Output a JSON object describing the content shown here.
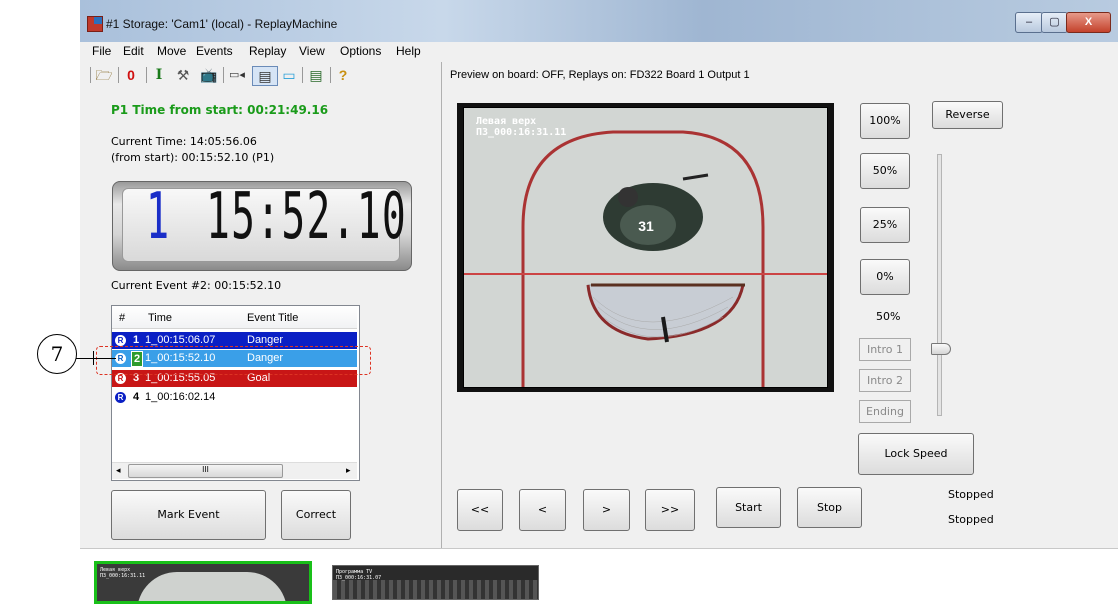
{
  "window": {
    "title": "#1 Storage: 'Cam1' (local) - ReplayMachine",
    "controls": {
      "minimize": "–",
      "maximize": "▢",
      "close": "X"
    }
  },
  "menu": [
    "File",
    "Edit",
    "Move",
    "Events",
    "Replay",
    "View",
    "Options",
    "Help"
  ],
  "toolbar": {
    "icons": [
      "open-folder-icon",
      "zero-icon",
      "input-icon",
      "tools-icon",
      "tv-icon",
      "camera-icon",
      "monitor-icon",
      "display-icon",
      "list-icon",
      "help-icon"
    ],
    "zero_label": "0",
    "input_label": "I",
    "help_label": "?"
  },
  "preview_status": "Preview on board: OFF, Replays on: FD322 Board 1 Output 1",
  "left": {
    "p1_time": "P1 Time from start: 00:21:49.16",
    "current_time": "Current Time: 14:05:56.06",
    "from_start": "(from start): 00:15:52.10 (P1)",
    "clock_hour": "1",
    "clock_rest": "15:52.10",
    "current_event": "Current Event #2: 00:15:52.10"
  },
  "events": {
    "headers": [
      "#",
      "Time",
      "Event Title"
    ],
    "rows": [
      {
        "icon": "R",
        "num": "1",
        "time": "1_00:15:06.07",
        "title": "Danger"
      },
      {
        "icon": "R",
        "num": "2",
        "time": "1_00:15:52.10",
        "title": "Danger"
      },
      {
        "icon": "R",
        "num": "3",
        "time": "1_00:15:55.05",
        "title": "Goal"
      },
      {
        "icon": "R",
        "num": "4",
        "time": "1_00:16:02.14",
        "title": ""
      }
    ],
    "scroll_left": "◂",
    "scroll_right": "▸",
    "scroll_grip": "III"
  },
  "callout": "7",
  "buttons": {
    "mark_event": "Mark Event",
    "correct": "Correct",
    "s100": "100%",
    "reverse": "Reverse",
    "s50": "50%",
    "s25": "25%",
    "s0": "0%",
    "intro1": "Intro 1",
    "intro2": "Intro 2",
    "ending": "Ending",
    "lock_speed": "Lock Speed",
    "rew": "<<",
    "prev": "<",
    "next": ">",
    "ff": ">>",
    "start": "Start",
    "stop": "Stop"
  },
  "speed_value": "50%",
  "speed_level_percent": 50,
  "video": {
    "label1": "Левая верх",
    "label2": "П3_000:16:31.11",
    "player_number": "31"
  },
  "status": {
    "line1": "Stopped",
    "line2": "Stopped"
  },
  "thumbnails": [
    {
      "label1": "Левая верх",
      "label2": "П3_000:16:31.11"
    },
    {
      "label1": "Программа TV",
      "label2": "П3_000:16:31.07"
    }
  ]
}
